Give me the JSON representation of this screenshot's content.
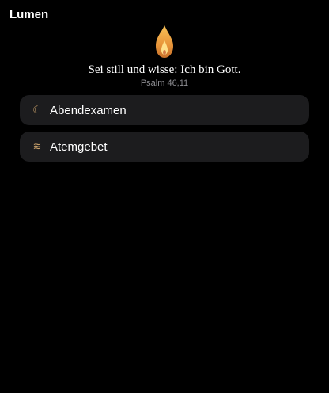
{
  "app": {
    "title": "Lumen"
  },
  "header": {
    "icon": "candle-flame-icon",
    "verse": "Sei still und wisse: Ich bin Gott.",
    "reference": "Psalm 46,11"
  },
  "menu": {
    "items": [
      {
        "icon": "moon-icon",
        "glyph": "☾",
        "label": "Abendexamen"
      },
      {
        "icon": "breath-waves-icon",
        "glyph": "≋",
        "label": "Atemgebet"
      }
    ]
  },
  "colors": {
    "background": "#000000",
    "card": "#1c1c1e",
    "accent": "#c8a06a",
    "flame_outer": "#e89a3c",
    "flame_inner": "#ffe08a",
    "muted_text": "#8e8e93"
  }
}
